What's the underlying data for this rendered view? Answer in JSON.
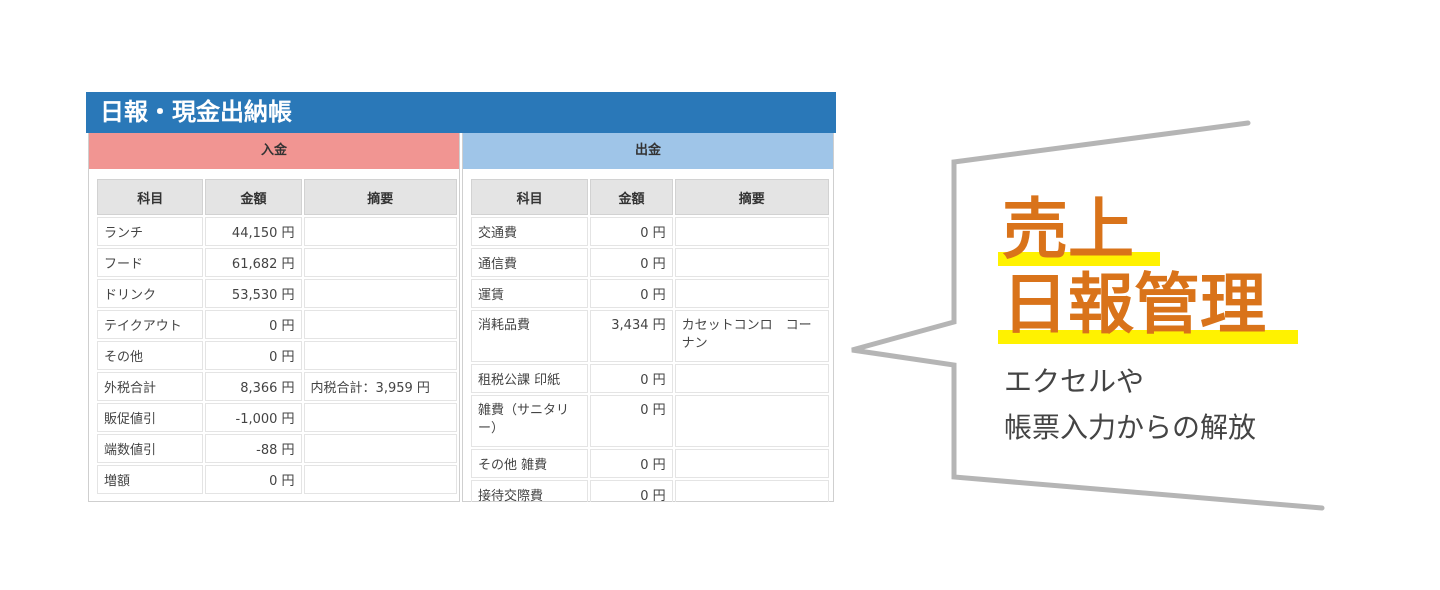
{
  "panel": {
    "title": "日報・現金出納帳"
  },
  "income": {
    "header": "入金",
    "columns": [
      "科目",
      "金額",
      "摘要"
    ],
    "rows": [
      [
        "ランチ",
        "44,150 円",
        ""
      ],
      [
        "フード",
        "61,682 円",
        ""
      ],
      [
        "ドリンク",
        "53,530 円",
        ""
      ],
      [
        "テイクアウト",
        "0 円",
        ""
      ],
      [
        "その他",
        "0 円",
        ""
      ],
      [
        "外税合計",
        "8,366 円",
        "内税合計：3,959 円"
      ],
      [
        "販促値引",
        "-1,000 円",
        ""
      ],
      [
        "端数値引",
        "-88 円",
        ""
      ],
      [
        "増額",
        "0 円",
        ""
      ]
    ]
  },
  "expense": {
    "header": "出金",
    "columns": [
      "科目",
      "金額",
      "摘要"
    ],
    "rows": [
      [
        "交通費",
        "0 円",
        ""
      ],
      [
        "通信費",
        "0 円",
        ""
      ],
      [
        "運賃",
        "0 円",
        ""
      ],
      [
        "消耗品費",
        "3,434 円",
        "カセットコンロ　コーナン"
      ],
      [
        "租税公課 印紙",
        "0 円",
        ""
      ],
      [
        "雑費（サニタリー）",
        "0 円",
        ""
      ],
      [
        "その他 雑費",
        "0 円",
        ""
      ],
      [
        "接待交際費",
        "0 円",
        ""
      ]
    ]
  },
  "callout": {
    "heading_line1": "売上",
    "heading_line2": "日報管理",
    "sub_line1": "エクセルや",
    "sub_line2": "帳票入力からの解放",
    "heading_color": "#d9731a",
    "highlight_color": "#fff200",
    "bubble_stroke": "#b5b5b5"
  }
}
